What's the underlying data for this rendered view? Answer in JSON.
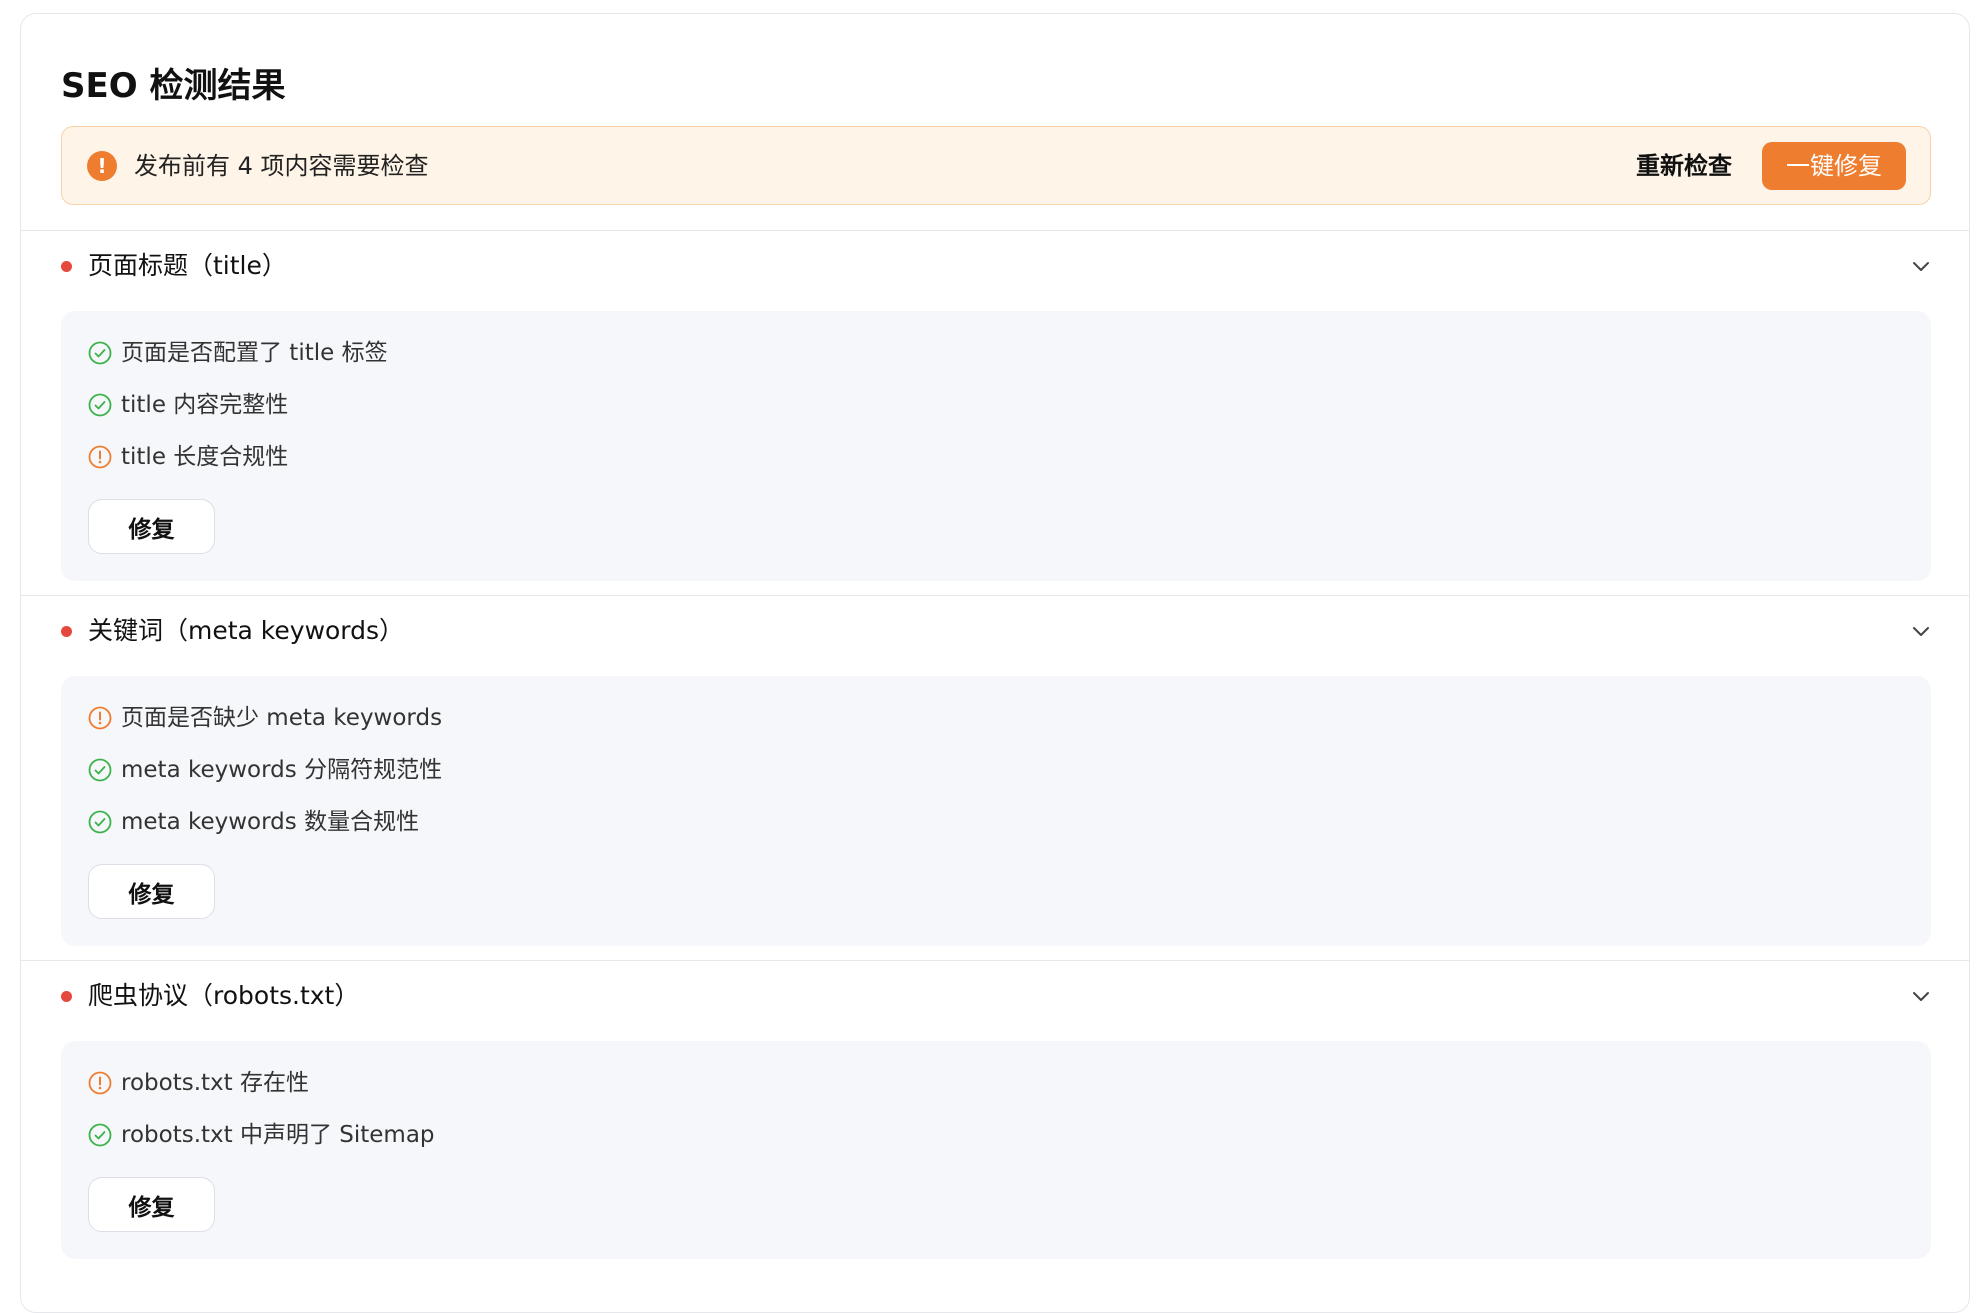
{
  "page": {
    "title": "SEO 检测结果"
  },
  "alert": {
    "icon": "exclamation-circle-icon",
    "text": "发布前有 4 项内容需要检查",
    "recheck_label": "重新检查",
    "fix_all_label": "一键修复"
  },
  "colors": {
    "accent": "#ef7d2f",
    "alert_background": "#fef4e8",
    "pass": "#3bb34a",
    "warn": "#ef7d2f",
    "section_dot": "#e5483d",
    "box_background": "#f6f7fa"
  },
  "sections": [
    {
      "title": "页面标题（title）",
      "expanded": true,
      "items": [
        {
          "status": "pass",
          "icon": "check-circle-icon",
          "text": "页面是否配置了 title 标签"
        },
        {
          "status": "pass",
          "icon": "check-circle-icon",
          "text": "title 内容完整性"
        },
        {
          "status": "warn",
          "icon": "warning-circle-icon",
          "text": "title 长度合规性"
        }
      ],
      "fix_label": "修复"
    },
    {
      "title": "关键词（meta keywords）",
      "expanded": true,
      "items": [
        {
          "status": "warn",
          "icon": "warning-circle-icon",
          "text": "页面是否缺少 meta keywords"
        },
        {
          "status": "pass",
          "icon": "check-circle-icon",
          "text": "meta keywords 分隔符规范性"
        },
        {
          "status": "pass",
          "icon": "check-circle-icon",
          "text": "meta keywords 数量合规性"
        }
      ],
      "fix_label": "修复"
    },
    {
      "title": "爬虫协议（robots.txt）",
      "expanded": true,
      "items": [
        {
          "status": "warn",
          "icon": "warning-circle-icon",
          "text": "robots.txt 存在性"
        },
        {
          "status": "pass",
          "icon": "check-circle-icon",
          "text": "robots.txt 中声明了 Sitemap"
        }
      ],
      "fix_label": "修复"
    }
  ]
}
